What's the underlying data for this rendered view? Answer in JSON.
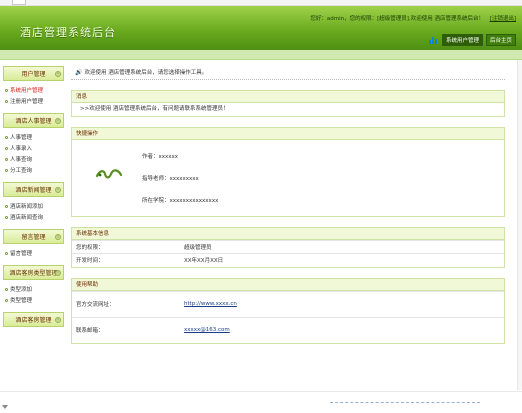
{
  "header": {
    "title": "酒店管理系统后台",
    "user_label": "您好：",
    "user_name": "admin",
    "user_sep": "，",
    "user_role": "您的权限：[超级管理员],欢迎使用 酒店管理系统后台！",
    "logout_label": "[注销退出]",
    "tabs": [
      {
        "label": "系统用户管理",
        "active": true
      },
      {
        "label": "后台主页",
        "active": false
      }
    ]
  },
  "sidebar": {
    "sections": [
      {
        "title": "用户管理",
        "items": [
          {
            "label": "系统用户管理",
            "active": true
          },
          {
            "label": "注册用户管理",
            "active": false
          }
        ]
      },
      {
        "title": "酒店人事管理",
        "items": [
          {
            "label": "人事管理"
          },
          {
            "label": "人事录入"
          },
          {
            "label": "人事查询"
          },
          {
            "label": "分工查询"
          }
        ]
      },
      {
        "title": "酒店新闻管理",
        "items": [
          {
            "label": "酒店新闻添加"
          },
          {
            "label": "酒店新闻查询"
          }
        ]
      },
      {
        "title": "留言管理",
        "items": [
          {
            "label": "留言管理"
          }
        ]
      },
      {
        "title": "酒店客房类型管理",
        "items": [
          {
            "label": "类型添加"
          },
          {
            "label": "类型管理"
          }
        ]
      },
      {
        "title": "酒店客房管理",
        "items": []
      }
    ]
  },
  "main": {
    "welcome": "欢迎使用 酒店管理系统后台，请您选择操作工具。",
    "message_panel": {
      "title": "消息",
      "text": ">>欢迎使用 酒店管理系统后台，有问题请联系系统管理员！"
    },
    "contact_panel": {
      "title": "快捷操作",
      "lines": [
        "作者：xxxxxx",
        "指导老师：xxxxxxxxx",
        "所在学院：xxxxxxxxxxxxxxx"
      ]
    },
    "sysinfo_panel": {
      "title": "系统基本信息",
      "rows": [
        {
          "k": "您的权限：",
          "v": "超级管理员"
        },
        {
          "k": "开发时间：",
          "v": "XX年XX月XX日"
        }
      ]
    },
    "help_panel": {
      "title": "使用帮助",
      "rows": [
        {
          "k": "官方交流网址：",
          "v": "http://www.xxxx.cn"
        },
        {
          "k": "联系邮箱：",
          "v": "xxxxx@163.com"
        }
      ]
    }
  },
  "colors": {
    "header_green": "#6aab1f",
    "panel_head_bg": "#f1f8d8",
    "panel_border": "#cfe3a6",
    "active_link": "#d1261a"
  },
  "icons": {
    "tab_bars": "bar-chart-icon",
    "welcome": "speaker-icon",
    "logo": "spiral-logo-icon",
    "toggle": "chevron-up-icon"
  }
}
